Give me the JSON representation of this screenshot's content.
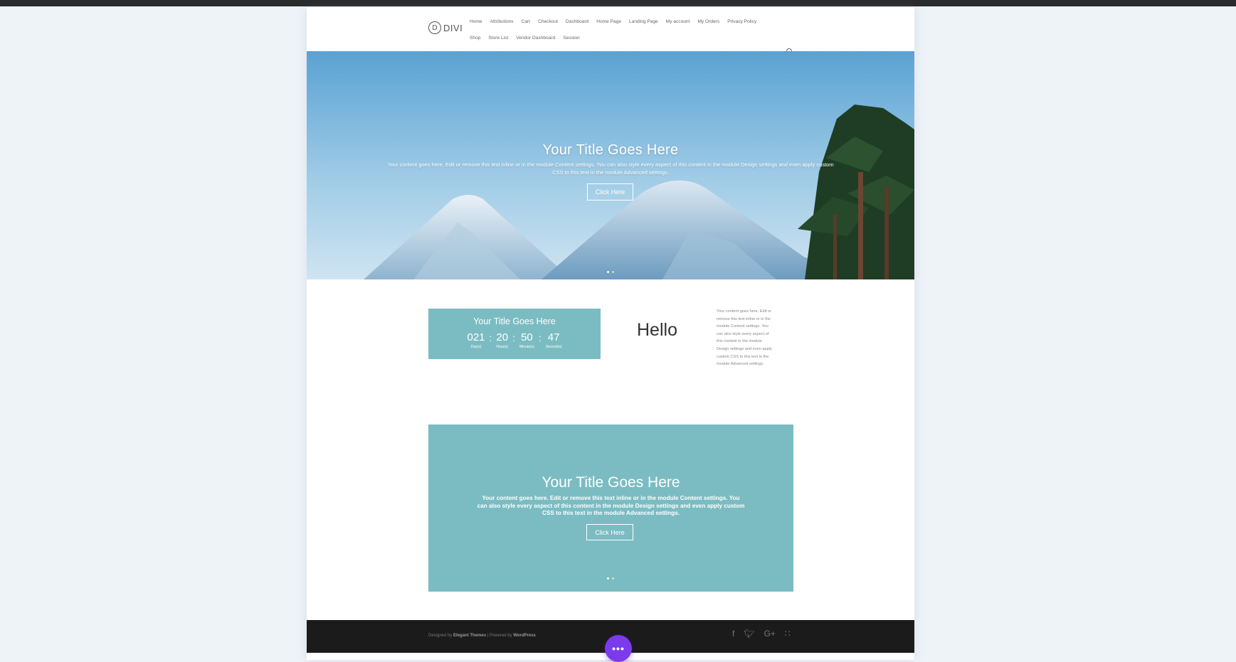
{
  "header": {
    "logo_mark": "D",
    "logo_text": "DIVI",
    "nav_row_1": [
      "Home",
      "Attributions",
      "Cart",
      "Checkout",
      "Dashboard",
      "Home Page",
      "Landing Page",
      "My account",
      "My Orders",
      "Privacy Policy"
    ],
    "nav_row_2": [
      "Shop",
      "Store List",
      "Vendor Dashboard",
      "Session"
    ]
  },
  "hero": {
    "title": "Your Title Goes Here",
    "body": "Your content goes here. Edit or remove this text inline or in the module Content settings. You can also style every aspect of this content in the module Design settings and even apply custom CSS to this text in the module Advanced settings.",
    "button_label": "Click Here"
  },
  "countdown": {
    "title": "Your Title Goes Here",
    "units": [
      {
        "value": "021",
        "label": "Day(s)"
      },
      {
        "value": "20",
        "label": "Hour(s)"
      },
      {
        "value": "50",
        "label": "Minute(s)"
      },
      {
        "value": "47",
        "label": "Second(s)"
      }
    ],
    "separator": ":"
  },
  "hello": "Hello",
  "side_text": "Your content goes here. Edit or remove this text inline or in the module Content settings. You can also style every aspect of this content in the module Design settings and even apply custom CSS to this text in the module Advanced settings.",
  "slider2": {
    "title": "Your Title Goes Here",
    "body": "Your content goes here. Edit or remove this text inline or in the module Content settings. You can also style every aspect of this content in the module Design settings and even apply custom CSS to this text in the module Advanced settings.",
    "button_label": "Click Here"
  },
  "footer": {
    "designed_by": "Designed by",
    "theme_name": "Elegant Themes",
    "powered_by": "| Powered by",
    "platform": "WordPress",
    "social_icons": [
      "facebook-icon",
      "twitter-icon",
      "google-plus-icon",
      "rss-icon"
    ]
  },
  "fab_label": "•••",
  "colors": {
    "accent_teal": "#7bbcc2",
    "fab_purple": "#7c3aed",
    "footer_bg": "#1b1b1b",
    "page_bg": "#eef3f8"
  }
}
